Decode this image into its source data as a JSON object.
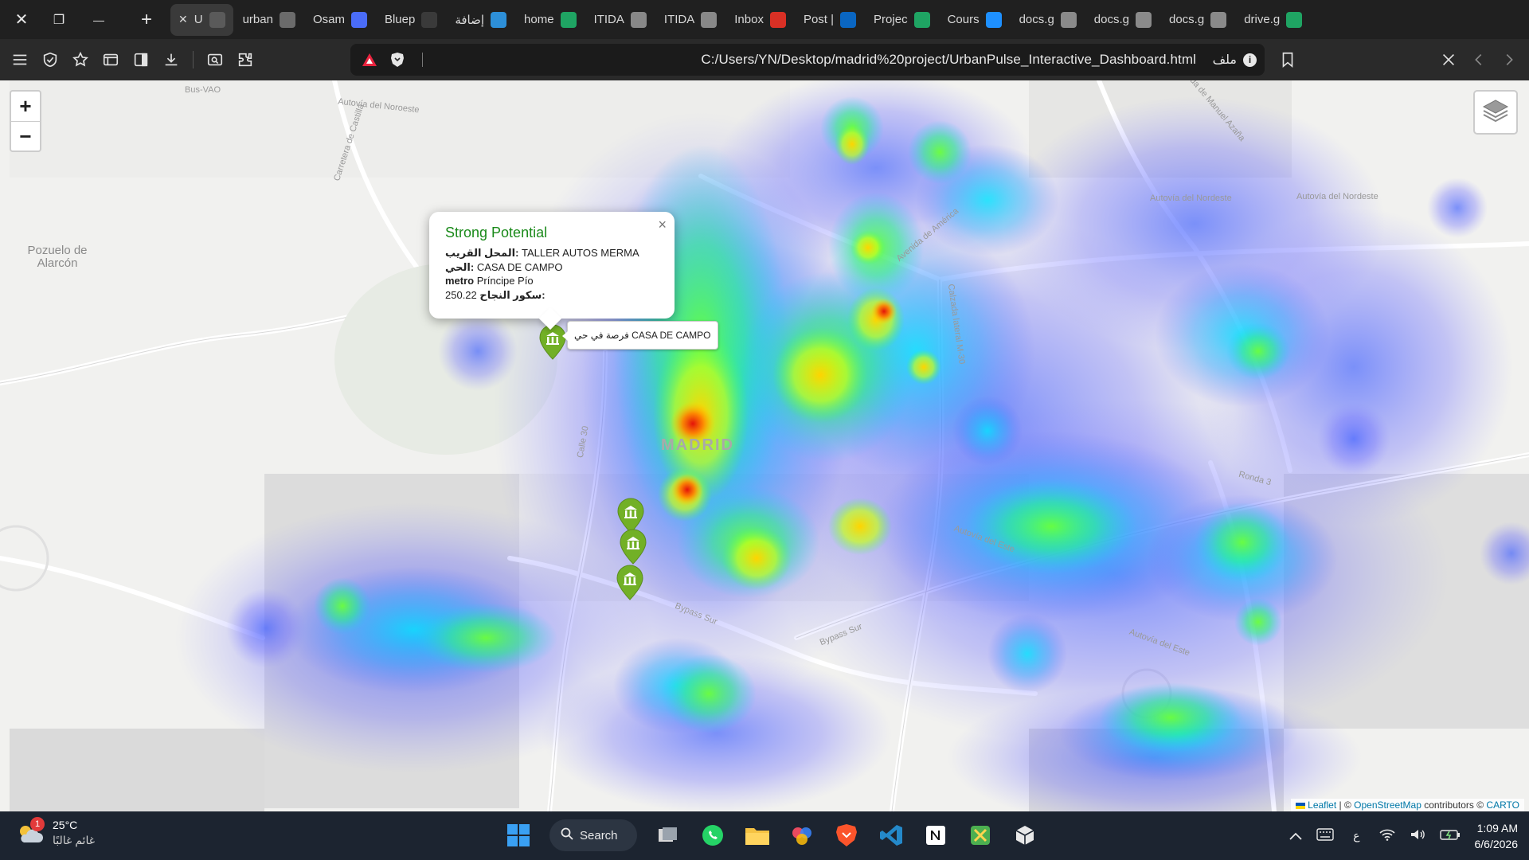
{
  "window": {
    "close_label": "✕",
    "restore_label": "❐",
    "minimize_label": "—",
    "newtab_label": "+"
  },
  "tabs": [
    {
      "label": "U",
      "active": true,
      "icon": "close-icon",
      "color": "#5a5a5a"
    },
    {
      "label": "urban",
      "icon": "globe-icon",
      "color": "#6b6b6b"
    },
    {
      "label": "Osam",
      "icon": "app-icon",
      "color": "#4a6cf7"
    },
    {
      "label": "Bluep",
      "icon": "chatgpt-icon",
      "color": "#3a3a3a"
    },
    {
      "label": "إضافة",
      "icon": "circle-app-icon",
      "color": "#2d8fd8"
    },
    {
      "label": "home",
      "icon": "drive-icon",
      "color": "#1fa463"
    },
    {
      "label": "ITIDA",
      "icon": "itida-icon",
      "color": "#888888"
    },
    {
      "label": "ITIDA",
      "icon": "itida-icon",
      "color": "#888888"
    },
    {
      "label": "Inbox",
      "icon": "gmail-icon",
      "color": "#d93025"
    },
    {
      "label": "Post |",
      "icon": "linkedin-icon",
      "color": "#0a66c2"
    },
    {
      "label": "Projec",
      "icon": "drive-icon",
      "color": "#1fa463"
    },
    {
      "label": "Cours",
      "icon": "sc-icon",
      "color": "#1e90ff"
    },
    {
      "label": "docs.g",
      "icon": "docs-icon",
      "color": "#8a8a8a"
    },
    {
      "label": "docs.g",
      "icon": "docs-icon",
      "color": "#8a8a8a"
    },
    {
      "label": "docs.g",
      "icon": "docs-icon",
      "color": "#8a8a8a"
    },
    {
      "label": "drive.g",
      "icon": "drive-icon",
      "color": "#1fa463"
    }
  ],
  "address": {
    "url": "C:/Users/YN/Desktop/madrid%20project/UrbanPulse_Interactive_Dashboard.html",
    "scheme_label": "ملف"
  },
  "map": {
    "zoom_in": "+",
    "zoom_out": "−",
    "city_label": "MADRID",
    "place_labels": [
      {
        "text": "Pozuelo de Alarcón"
      }
    ],
    "road_labels": [
      "Autovía del Noroeste",
      "Carretera de Castilla",
      "Avenida de América",
      "Autovía del Nordeste",
      "Autovía del Nordeste",
      "Calzada lateral M-30",
      "Calle 30",
      "Autovía del Este",
      "Autovía del Este",
      "Bypass Sur",
      "Bypass Sur",
      "Ronda 3",
      "Bus-VAO",
      "Avenida de Manuel Azaña"
    ],
    "popup": {
      "title": "Strong Potential",
      "lines": [
        {
          "key": "المحل القريب:",
          "value": "TALLER AUTOS MERMA"
        },
        {
          "key": "الحي:",
          "value": "CASA DE CAMPO"
        },
        {
          "key": "metro",
          "value": "Príncipe Pío"
        },
        {
          "key": "سكور النجاح:",
          "value": "250.22"
        }
      ],
      "close": "×"
    },
    "tooltip": "فرصة في حي CASA DE CAMPO",
    "markers": [
      "museum-marker-icon",
      "museum-marker-icon",
      "museum-marker-icon",
      "museum-marker-icon"
    ],
    "marker_color": "#72b026",
    "attribution": {
      "leaflet": "Leaflet",
      "sep": " | © ",
      "osm": "OpenStreetMap",
      "mid": " contributors © ",
      "carto": "CARTO"
    }
  },
  "taskbar": {
    "weather_temp": "25°C",
    "weather_desc": "غائم غالبًا",
    "weather_badge": "1",
    "search_label": "Search",
    "lang": "ع",
    "time": "1:09 AM",
    "date": "6/6/2026"
  }
}
